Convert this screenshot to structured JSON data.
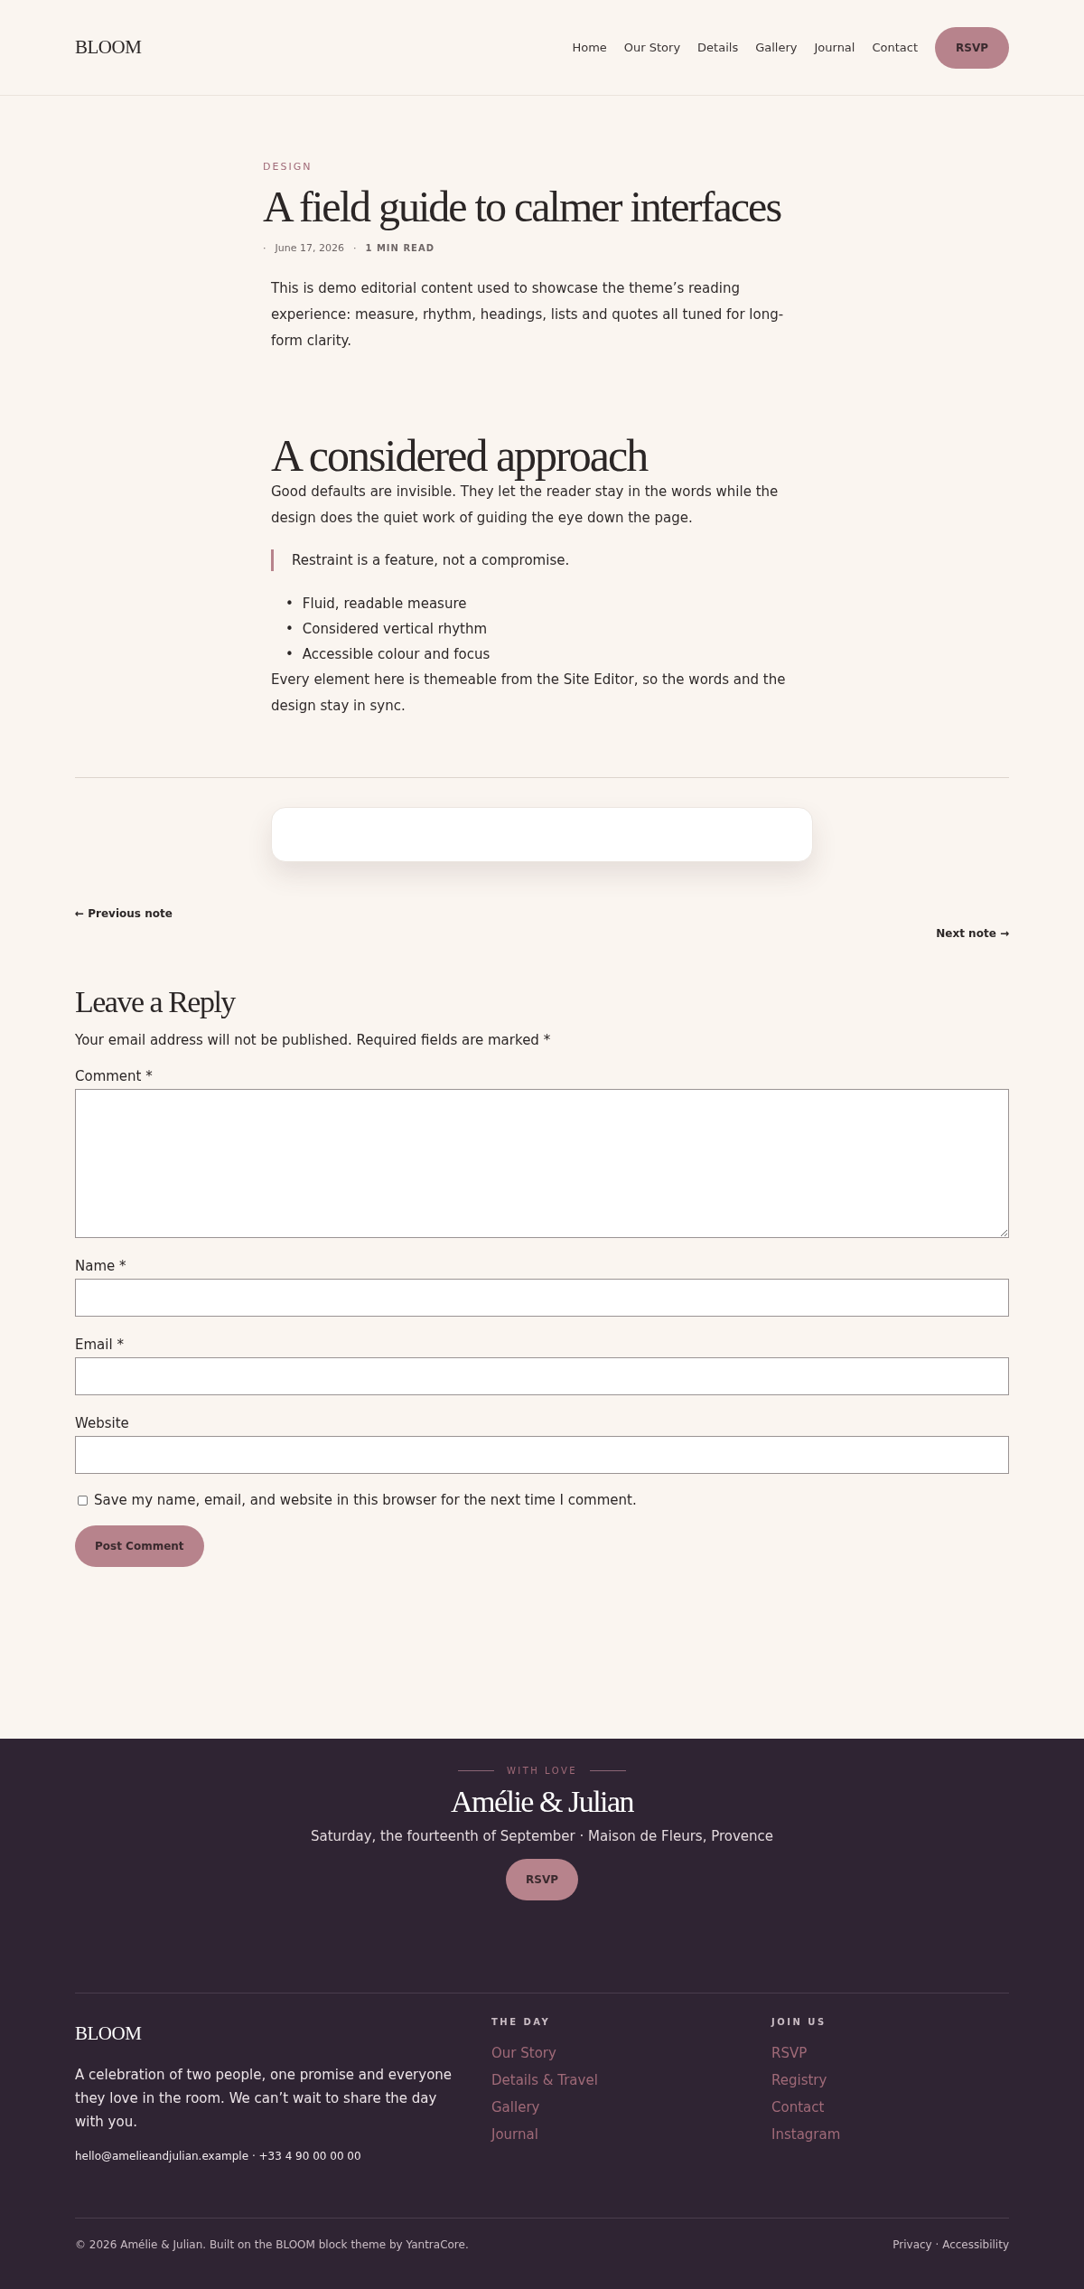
{
  "header": {
    "logo": "BLOOM",
    "nav": [
      "Home",
      "Our Story",
      "Details",
      "Gallery",
      "Journal",
      "Contact"
    ],
    "cta": "RSVP"
  },
  "article": {
    "category": "DESIGN",
    "title": "A field guide to calmer interfaces",
    "meta_sep": "·",
    "date": "June 17, 2026",
    "read_time": "1 MIN READ",
    "intro": "This is demo editorial content used to showcase the theme’s reading experience: measure, rhythm, headings, lists and quotes all tuned for long-form clarity.",
    "heading": "A considered approach",
    "paragraph": "Good defaults are invisible. They let the reader stay in the words while the design does the quiet work of guiding the eye down the page.",
    "quote": "Restraint is a feature, not a compromise.",
    "bullet": "•",
    "list": [
      "Fluid, readable measure",
      "Considered vertical rhythm",
      "Accessible colour and focus"
    ],
    "closing": "Every element here is themeable from the Site Editor, so the words and the design stay in sync."
  },
  "post_nav": {
    "previous": "← Previous note",
    "next": "Next note →"
  },
  "reply": {
    "title": "Leave a Reply",
    "note": "Your email address will not be published. Required fields are marked *",
    "fields": [
      {
        "label": "Comment *",
        "kind": "textarea"
      },
      {
        "label": "Name *",
        "kind": "text"
      },
      {
        "label": "Email *",
        "kind": "text"
      },
      {
        "label": "Website",
        "kind": "text"
      }
    ],
    "consent": {
      "label": "Save my name, email, and website in this browser for the next time I comment.",
      "checked": false
    },
    "submit": "Post Comment"
  },
  "footer": {
    "eyebrow": "WITH LOVE",
    "names": "Amélie & Julian",
    "details": "Saturday, the fourteenth of September · Maison de Fleurs, Provence",
    "cta": "RSVP",
    "logo": "BLOOM",
    "about": "A celebration of two people, one promise and everyone they love in the room. We can’t wait to share the day with you.",
    "contact": "hello@amelieandjulian.example · +33 4 90 00 00 00",
    "columns": [
      {
        "title": "THE DAY",
        "links": [
          "Our Story",
          "Details & Travel",
          "Gallery",
          "Journal"
        ]
      },
      {
        "title": "JOIN US",
        "links": [
          "RSVP",
          "Registry",
          "Contact",
          "Instagram"
        ]
      }
    ],
    "copyright": "© 2026 Amélie & Julian. Built on the BLOOM block theme by YantraCore.",
    "legal": "Privacy · Accessibility"
  }
}
